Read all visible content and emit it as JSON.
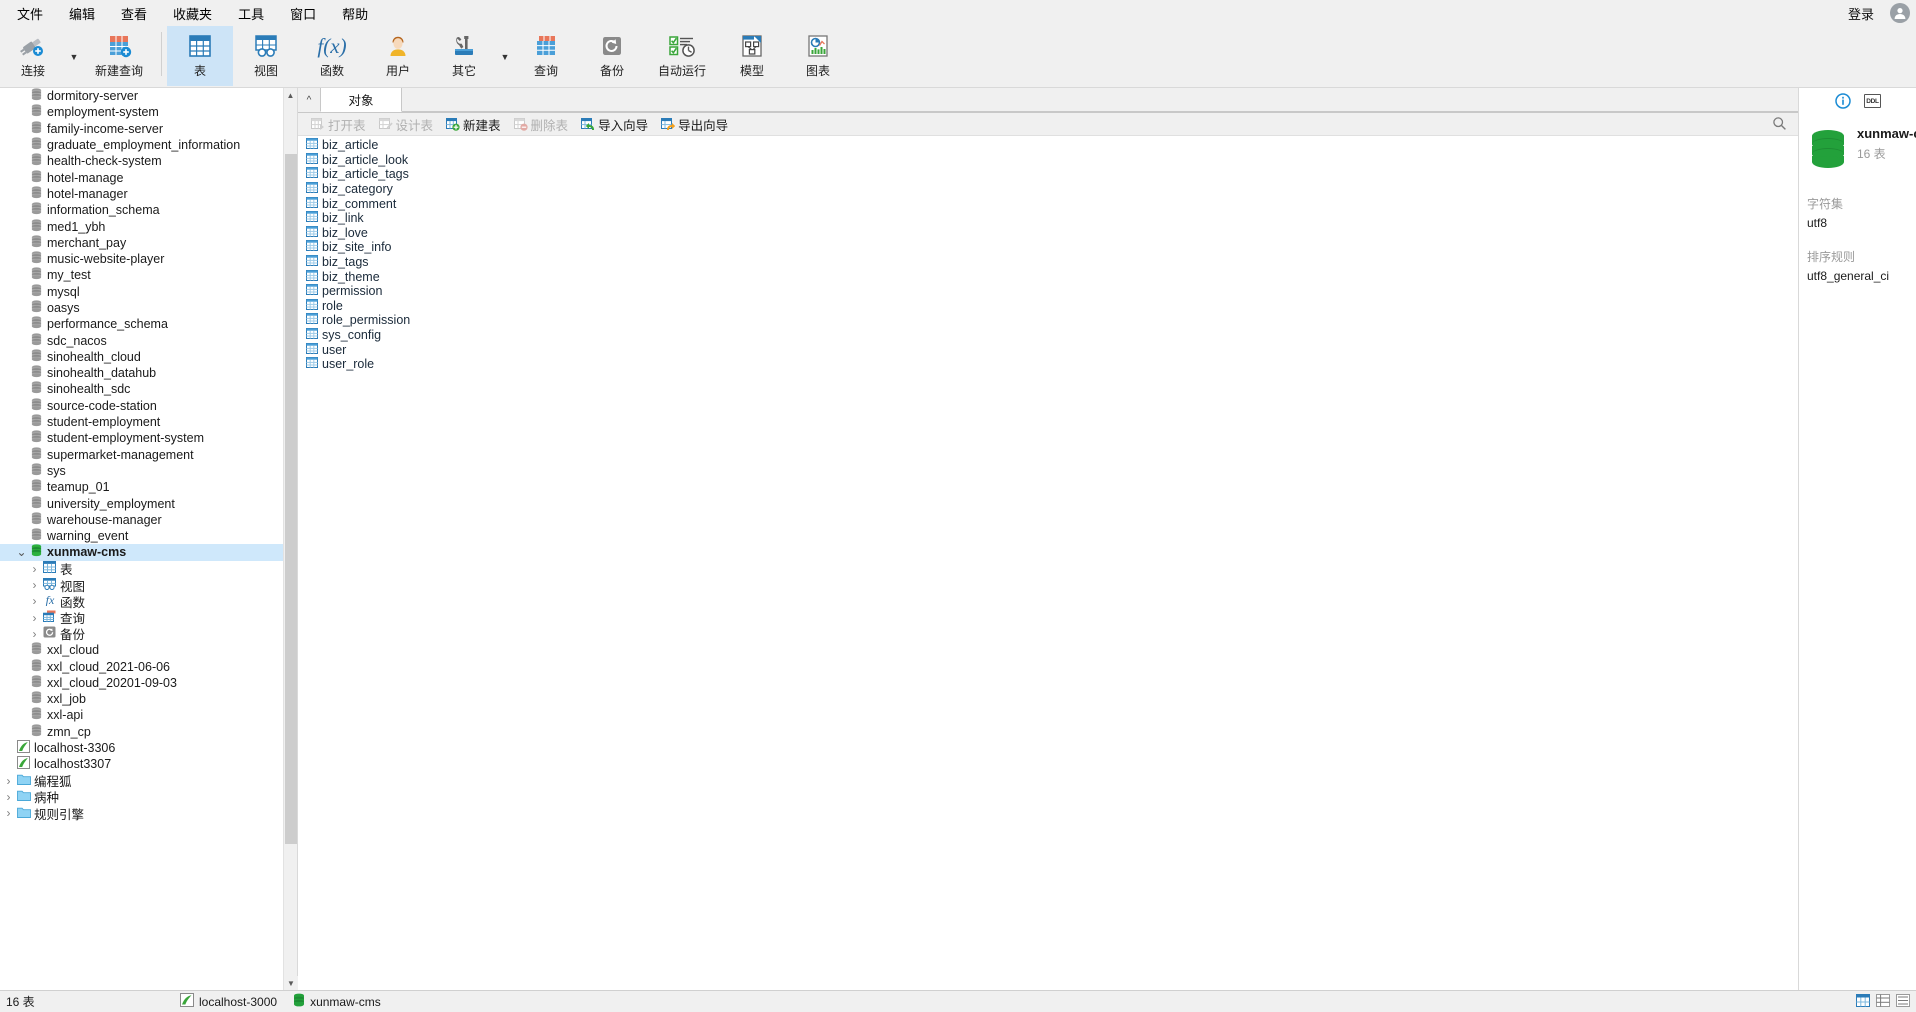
{
  "menubar": {
    "items": [
      "文件",
      "编辑",
      "查看",
      "收藏夹",
      "工具",
      "窗口",
      "帮助"
    ],
    "login_label": "登录",
    "avatar_icon": "user-avatar-icon"
  },
  "ribbon": {
    "items": [
      {
        "label": "连接",
        "icon": "connection-icon",
        "has_caret": true,
        "active": false
      },
      {
        "label": "新建查询",
        "icon": "new-query-icon",
        "has_caret": false,
        "active": false
      },
      {
        "label": "表",
        "icon": "table-icon",
        "has_caret": false,
        "active": true
      },
      {
        "label": "视图",
        "icon": "view-icon",
        "has_caret": false,
        "active": false
      },
      {
        "label": "函数",
        "icon": "function-icon",
        "has_caret": false,
        "active": false
      },
      {
        "label": "用户",
        "icon": "user-icon",
        "has_caret": false,
        "active": false
      },
      {
        "label": "其它",
        "icon": "other-tools-icon",
        "has_caret": true,
        "active": false
      },
      {
        "label": "查询",
        "icon": "query-icon",
        "has_caret": false,
        "active": false
      },
      {
        "label": "备份",
        "icon": "backup-icon",
        "has_caret": false,
        "active": false
      },
      {
        "label": "自动运行",
        "icon": "automation-icon",
        "has_caret": false,
        "active": false
      },
      {
        "label": "模型",
        "icon": "model-icon",
        "has_caret": false,
        "active": false
      },
      {
        "label": "图表",
        "icon": "chart-icon",
        "has_caret": false,
        "active": false
      }
    ]
  },
  "tree": [
    {
      "label": "dormitory-server",
      "icon": "database-icon",
      "indent": 1,
      "arrow": "",
      "selected": false
    },
    {
      "label": "employment-system",
      "icon": "database-icon",
      "indent": 1,
      "arrow": "",
      "selected": false
    },
    {
      "label": "family-income-server",
      "icon": "database-icon",
      "indent": 1,
      "arrow": "",
      "selected": false
    },
    {
      "label": "graduate_employment_information",
      "icon": "database-icon",
      "indent": 1,
      "arrow": "",
      "selected": false
    },
    {
      "label": "health-check-system",
      "icon": "database-icon",
      "indent": 1,
      "arrow": "",
      "selected": false
    },
    {
      "label": "hotel-manage",
      "icon": "database-icon",
      "indent": 1,
      "arrow": "",
      "selected": false
    },
    {
      "label": "hotel-manager",
      "icon": "database-icon",
      "indent": 1,
      "arrow": "",
      "selected": false
    },
    {
      "label": "information_schema",
      "icon": "database-icon",
      "indent": 1,
      "arrow": "",
      "selected": false
    },
    {
      "label": "med1_ybh",
      "icon": "database-icon",
      "indent": 1,
      "arrow": "",
      "selected": false
    },
    {
      "label": "merchant_pay",
      "icon": "database-icon",
      "indent": 1,
      "arrow": "",
      "selected": false
    },
    {
      "label": "music-website-player",
      "icon": "database-icon",
      "indent": 1,
      "arrow": "",
      "selected": false
    },
    {
      "label": "my_test",
      "icon": "database-icon",
      "indent": 1,
      "arrow": "",
      "selected": false
    },
    {
      "label": "mysql",
      "icon": "database-icon",
      "indent": 1,
      "arrow": "",
      "selected": false
    },
    {
      "label": "oasys",
      "icon": "database-icon",
      "indent": 1,
      "arrow": "",
      "selected": false
    },
    {
      "label": "performance_schema",
      "icon": "database-icon",
      "indent": 1,
      "arrow": "",
      "selected": false
    },
    {
      "label": "sdc_nacos",
      "icon": "database-icon",
      "indent": 1,
      "arrow": "",
      "selected": false
    },
    {
      "label": "sinohealth_cloud",
      "icon": "database-icon",
      "indent": 1,
      "arrow": "",
      "selected": false
    },
    {
      "label": "sinohealth_datahub",
      "icon": "database-icon",
      "indent": 1,
      "arrow": "",
      "selected": false
    },
    {
      "label": "sinohealth_sdc",
      "icon": "database-icon",
      "indent": 1,
      "arrow": "",
      "selected": false
    },
    {
      "label": "source-code-station",
      "icon": "database-icon",
      "indent": 1,
      "arrow": "",
      "selected": false
    },
    {
      "label": "student-employment",
      "icon": "database-icon",
      "indent": 1,
      "arrow": "",
      "selected": false
    },
    {
      "label": "student-employment-system",
      "icon": "database-icon",
      "indent": 1,
      "arrow": "",
      "selected": false
    },
    {
      "label": "supermarket-management",
      "icon": "database-icon",
      "indent": 1,
      "arrow": "",
      "selected": false
    },
    {
      "label": "sys",
      "icon": "database-icon",
      "indent": 1,
      "arrow": "",
      "selected": false
    },
    {
      "label": "teamup_01",
      "icon": "database-icon",
      "indent": 1,
      "arrow": "",
      "selected": false
    },
    {
      "label": "university_employment",
      "icon": "database-icon",
      "indent": 1,
      "arrow": "",
      "selected": false
    },
    {
      "label": "warehouse-manager",
      "icon": "database-icon",
      "indent": 1,
      "arrow": "",
      "selected": false
    },
    {
      "label": "warning_event",
      "icon": "database-icon",
      "indent": 1,
      "arrow": "",
      "selected": false
    },
    {
      "label": "xunmaw-cms",
      "icon": "database-open-icon",
      "indent": 1,
      "arrow": "open",
      "selected": true
    },
    {
      "label": "表",
      "icon": "tables-folder-icon",
      "indent": 2,
      "arrow": "closed",
      "selected": false
    },
    {
      "label": "视图",
      "icon": "views-folder-icon",
      "indent": 2,
      "arrow": "closed",
      "selected": false
    },
    {
      "label": "函数",
      "icon": "functions-folder-icon",
      "indent": 2,
      "arrow": "closed",
      "selected": false
    },
    {
      "label": "查询",
      "icon": "queries-folder-icon",
      "indent": 2,
      "arrow": "closed",
      "selected": false
    },
    {
      "label": "备份",
      "icon": "backups-folder-icon",
      "indent": 2,
      "arrow": "closed",
      "selected": false
    },
    {
      "label": "xxl_cloud",
      "icon": "database-icon",
      "indent": 1,
      "arrow": "",
      "selected": false
    },
    {
      "label": "xxl_cloud_2021-06-06",
      "icon": "database-icon",
      "indent": 1,
      "arrow": "",
      "selected": false
    },
    {
      "label": "xxl_cloud_20201-09-03",
      "icon": "database-icon",
      "indent": 1,
      "arrow": "",
      "selected": false
    },
    {
      "label": "xxl_job",
      "icon": "database-icon",
      "indent": 1,
      "arrow": "",
      "selected": false
    },
    {
      "label": "xxl-api",
      "icon": "database-icon",
      "indent": 1,
      "arrow": "",
      "selected": false
    },
    {
      "label": "zmn_cp",
      "icon": "database-icon",
      "indent": 1,
      "arrow": "",
      "selected": false
    },
    {
      "label": "localhost-3306",
      "icon": "mysql-connection-icon",
      "indent": 0,
      "arrow": "",
      "selected": false
    },
    {
      "label": "localhost3307",
      "icon": "mysql-connection-icon",
      "indent": 0,
      "arrow": "",
      "selected": false
    },
    {
      "label": "编程狐",
      "icon": "folder-icon",
      "indent": 0,
      "arrow": "closed",
      "selected": false
    },
    {
      "label": "病种",
      "icon": "folder-icon",
      "indent": 0,
      "arrow": "closed",
      "selected": false
    },
    {
      "label": "规则引擎",
      "icon": "folder-icon",
      "indent": 0,
      "arrow": "closed",
      "selected": false
    }
  ],
  "center": {
    "tab_label": "对象",
    "object_toolbar": [
      {
        "label": "打开表",
        "icon": "open-table-icon",
        "disabled": true
      },
      {
        "label": "设计表",
        "icon": "design-table-icon",
        "disabled": true
      },
      {
        "label": "新建表",
        "icon": "new-table-icon",
        "disabled": false
      },
      {
        "label": "删除表",
        "icon": "delete-table-icon",
        "disabled": true
      },
      {
        "label": "导入向导",
        "icon": "import-wizard-icon",
        "disabled": false
      },
      {
        "label": "导出向导",
        "icon": "export-wizard-icon",
        "disabled": false
      }
    ],
    "search_icon": "search-icon",
    "tables": [
      "biz_article",
      "biz_article_look",
      "biz_article_tags",
      "biz_category",
      "biz_comment",
      "biz_link",
      "biz_love",
      "biz_site_info",
      "biz_tags",
      "biz_theme",
      "permission",
      "role",
      "role_permission",
      "sys_config",
      "user",
      "user_role"
    ]
  },
  "rightpane": {
    "info_icon": "info-icon",
    "ddl_label": "DDL",
    "db_icon": "database-green-icon",
    "db_name": "xunmaw-c",
    "db_count": "16 表",
    "fields": [
      {
        "label": "字符集",
        "value": "utf8"
      },
      {
        "label": "排序规则",
        "value": "utf8_general_ci"
      }
    ]
  },
  "statusbar": {
    "count_label": "16 表",
    "connection_name": "localhost-3000",
    "connection_icon": "mysql-connection-icon",
    "database_name": "xunmaw-cms",
    "database_icon": "database-green-icon",
    "view_modes": [
      "grid-view-icon",
      "detail-view-icon",
      "list-view-icon"
    ]
  },
  "colors": {
    "accent": "#cfe8fb",
    "ribbon_active": "#cde4f7",
    "table_blue": "#3f8fd0",
    "db_green": "#23a13b",
    "disabled_gray": "#b0b0b0"
  }
}
